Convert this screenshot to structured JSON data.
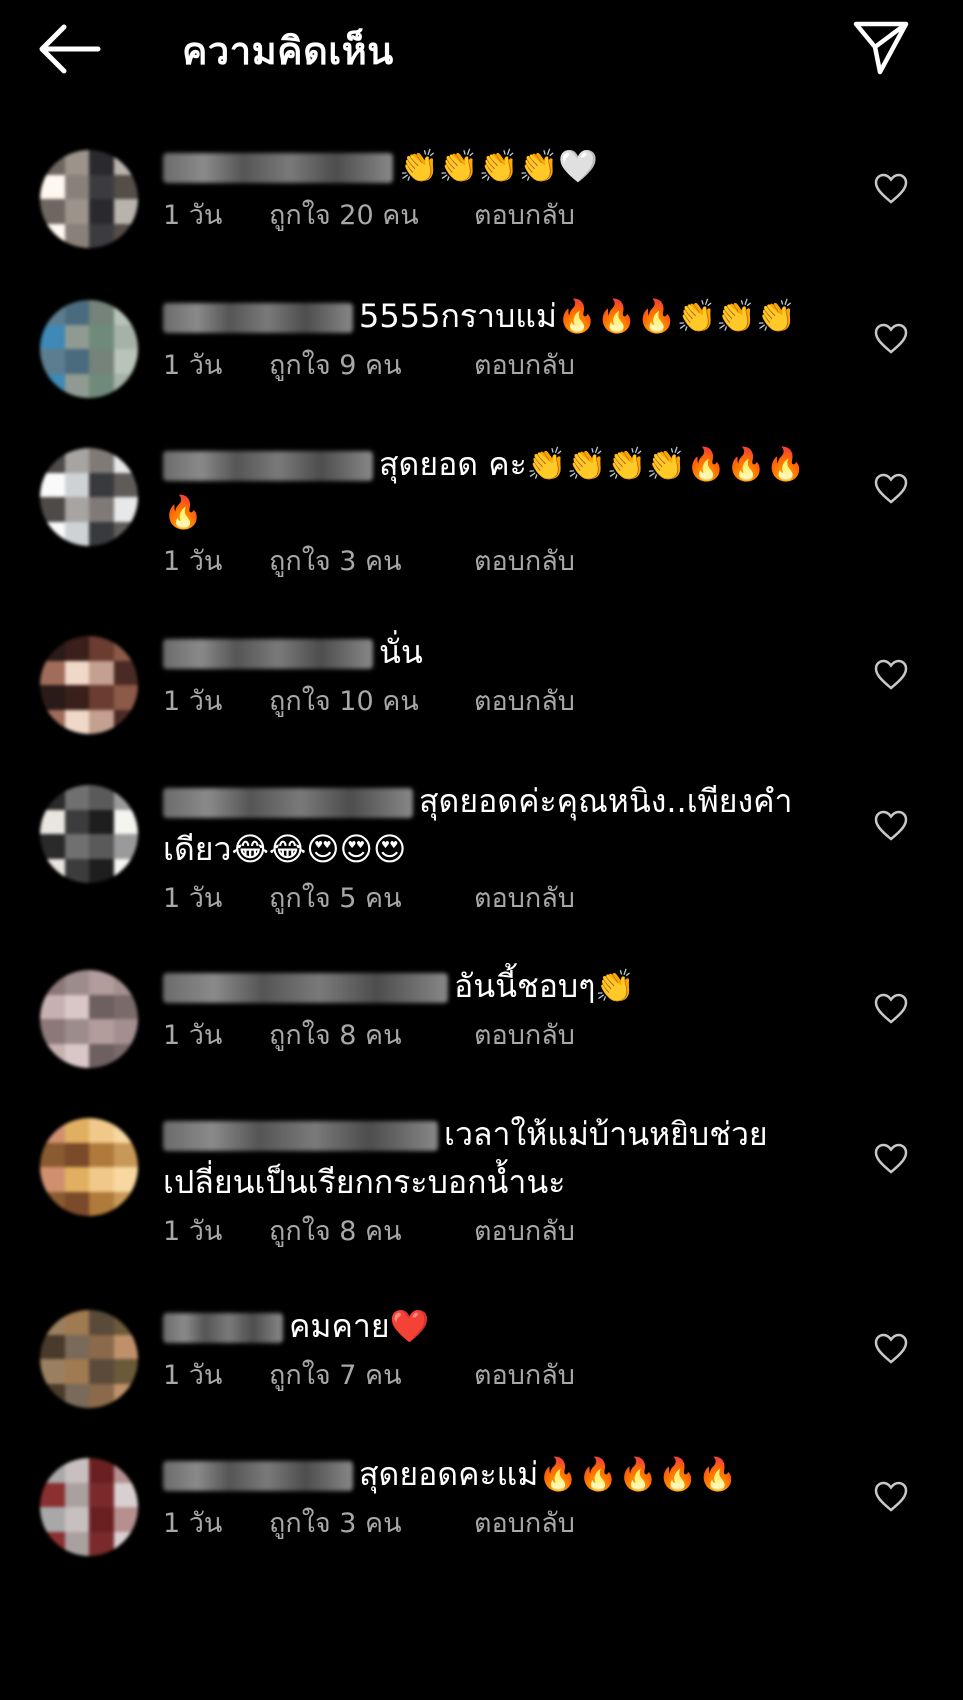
{
  "header": {
    "title": "ความคิดเห็น"
  },
  "comments": [
    {
      "text": "👏👏👏👏🤍",
      "cont": "",
      "time": "1 วัน",
      "likes": "ถูกใจ 20 คน",
      "reply": "ตอบกลับ"
    },
    {
      "text": "5555กราบแม่🔥🔥🔥👏👏👏",
      "cont": "",
      "time": "1 วัน",
      "likes": "ถูกใจ 9 คน",
      "reply": "ตอบกลับ"
    },
    {
      "text": "สุดยอด คะ👏👏👏👏🔥🔥🔥",
      "cont": "🔥",
      "time": "1 วัน",
      "likes": "ถูกใจ 3 คน",
      "reply": "ตอบกลับ"
    },
    {
      "text": "นั่น",
      "cont": "",
      "time": "1 วัน",
      "likes": "ถูกใจ 10 คน",
      "reply": "ตอบกลับ"
    },
    {
      "text": "สุดยอดค่ะคุณหนิง..เพียงคำ",
      "cont": "เดียว😂😂😍😍😍",
      "time": "1 วัน",
      "likes": "ถูกใจ 5 คน",
      "reply": "ตอบกลับ"
    },
    {
      "text": "อันนี้ชอบๆ👏",
      "cont": "",
      "time": "1 วัน",
      "likes": "ถูกใจ 8 คน",
      "reply": "ตอบกลับ"
    },
    {
      "text": "เวลาให้แม่บ้านหยิบช่วย",
      "cont": "เปลี่ยนเป็นเรียกกระบอกน้ำนะ",
      "time": "1 วัน",
      "likes": "ถูกใจ 8 คน",
      "reply": "ตอบกลับ"
    },
    {
      "text": "คมคาย❤️",
      "cont": "",
      "time": "1 วัน",
      "likes": "ถูกใจ 7 คน",
      "reply": "ตอบกลับ"
    },
    {
      "text": "สุดยอดคะแม่🔥🔥🔥🔥🔥",
      "cont": "",
      "time": "1 วัน",
      "likes": "ถูกใจ 3 คน",
      "reply": "ตอบกลับ"
    }
  ]
}
